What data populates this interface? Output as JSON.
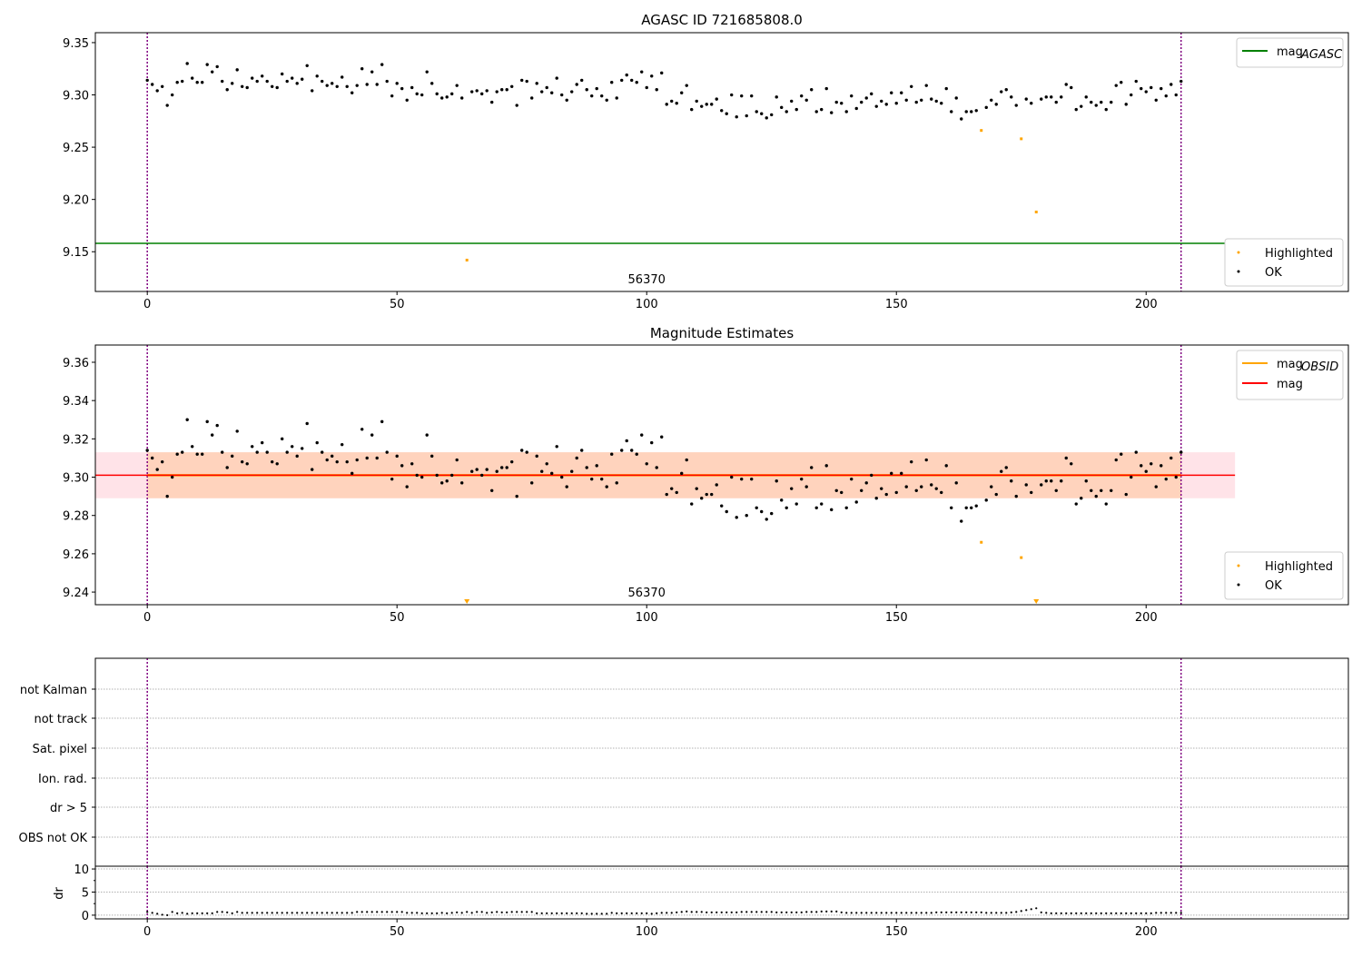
{
  "colors": {
    "ok": "#000000",
    "highlighted": "#ffa500",
    "agasc": "#008000",
    "obsid": "#ffa500",
    "mag": "#ff0000",
    "obs_line": "#800080",
    "band_mag": "#ffc0cb",
    "band_obsid": "#ffc8a0",
    "grid": "#b0b0b0"
  },
  "chart_data": [
    {
      "type": "scatter",
      "title": "AGASC ID 721685808.0",
      "xlim": [
        -10.4,
        240.5
      ],
      "ylim": [
        9.112,
        9.3595
      ],
      "xticks": [
        0,
        50,
        100,
        150,
        200
      ],
      "yticks": [
        9.15,
        9.2,
        9.25,
        9.3,
        9.35
      ],
      "obs_lines": [
        0,
        207
      ],
      "annotation": {
        "text": "56370",
        "x": 100
      },
      "mag_agasc": {
        "value": 9.158,
        "xrange": [
          -10.4,
          217.8
        ]
      },
      "legend_lines": [
        {
          "label": "mag",
          "sub": "AGASC",
          "color_key": "agasc"
        }
      ],
      "legend_points": [
        "Highlighted",
        "OK"
      ],
      "legend_placement": [
        "upper-right",
        "lower-right"
      ],
      "ok": [
        9.314,
        9.31,
        9.304,
        9.308,
        9.29,
        9.3,
        9.312,
        9.313,
        9.33,
        9.316,
        9.312,
        9.312,
        9.329,
        9.322,
        9.327,
        9.313,
        9.305,
        9.311,
        9.324,
        9.308,
        9.307,
        9.316,
        9.313,
        9.318,
        9.313,
        9.308,
        9.307,
        9.32,
        9.313,
        9.316,
        9.311,
        9.315,
        9.328,
        9.304,
        9.318,
        9.313,
        9.309,
        9.311,
        9.308,
        9.317,
        9.308,
        9.302,
        9.309,
        9.325,
        9.31,
        9.322,
        9.31,
        9.329,
        9.313,
        9.299,
        9.311,
        9.306,
        9.295,
        9.307,
        9.301,
        9.3,
        9.322,
        9.311,
        9.301,
        9.297,
        9.298,
        9.301,
        9.309,
        9.297,
        null,
        9.303,
        9.304,
        9.301,
        9.304,
        9.293,
        9.303,
        9.305,
        9.305,
        9.308,
        9.29,
        9.314,
        9.313,
        9.297,
        9.311,
        9.303,
        9.307,
        9.302,
        9.316,
        9.3,
        9.295,
        9.303,
        9.31,
        9.314,
        9.305,
        9.299,
        9.306,
        9.299,
        9.295,
        9.312,
        9.297,
        9.314,
        9.319,
        9.314,
        9.312,
        9.322,
        9.307,
        9.318,
        9.305,
        9.321,
        9.291,
        9.294,
        9.292,
        9.302,
        9.309,
        9.286,
        9.294,
        9.289,
        9.291,
        9.291,
        9.296,
        9.285,
        9.282,
        9.3,
        9.279,
        9.299,
        9.28,
        9.299,
        9.284,
        9.282,
        9.278,
        9.281,
        9.298,
        9.288,
        9.284,
        9.294,
        9.286,
        9.299,
        9.295,
        9.305,
        9.284,
        9.286,
        9.306,
        9.283,
        9.293,
        9.292,
        9.284,
        9.299,
        9.287,
        9.293,
        9.297,
        9.301,
        9.289,
        9.294,
        9.291,
        9.302,
        9.292,
        9.302,
        9.295,
        9.308,
        9.293,
        9.295,
        9.309,
        9.296,
        9.294,
        9.292,
        9.306,
        9.284,
        9.297,
        9.277,
        9.284,
        9.284,
        9.285,
        null,
        9.288,
        9.295,
        9.291,
        9.303,
        9.305,
        9.298,
        9.29,
        null,
        9.296,
        9.292,
        null,
        9.296,
        9.298,
        9.298,
        9.293,
        9.298,
        9.31,
        9.307,
        9.286,
        9.289,
        9.298,
        9.293,
        9.29,
        9.293,
        9.286,
        9.293,
        9.309,
        9.312,
        9.291,
        9.3,
        9.313,
        9.306,
        9.303,
        9.307,
        9.295,
        9.306,
        9.299,
        9.31,
        9.3,
        9.313
      ],
      "highlighted": [
        {
          "x": 64,
          "y": 9.142
        },
        {
          "x": 167,
          "y": 9.266
        },
        {
          "x": 175,
          "y": 9.258
        },
        {
          "x": 178,
          "y": 9.188
        }
      ]
    },
    {
      "type": "scatter",
      "title": "Magnitude Estimates",
      "xlim": [
        -10.4,
        240.5
      ],
      "ylim": [
        9.2334,
        9.369
      ],
      "xticks": [
        0,
        50,
        100,
        150,
        200
      ],
      "yticks": [
        9.24,
        9.26,
        9.28,
        9.3,
        9.32,
        9.34,
        9.36
      ],
      "obs_lines": [
        0,
        207
      ],
      "annotation": {
        "text": "56370",
        "x": 100
      },
      "mag": {
        "value": 9.301,
        "band": [
          9.289,
          9.313
        ],
        "xrange": [
          -10.4,
          217.8
        ]
      },
      "mag_obsid": {
        "value": 9.301,
        "band": [
          9.289,
          9.313
        ],
        "xrange": [
          0,
          207
        ]
      },
      "legend_lines": [
        {
          "label": "mag",
          "sub": "OBSID",
          "color_key": "obsid"
        },
        {
          "label": "mag",
          "sub": "",
          "color_key": "mag"
        }
      ],
      "legend_points": [
        "Highlighted",
        "OK"
      ],
      "legend_placement": [
        "upper-right",
        "lower-right"
      ],
      "highlighted_in_range": [
        {
          "x": 167,
          "y": 9.266
        },
        {
          "x": 175,
          "y": 9.258
        }
      ],
      "highlighted_below_range": [
        64,
        178
      ]
    },
    {
      "type": "scatter",
      "flags": [
        "not Kalman",
        "not track",
        "Sat. pixel",
        "Ion. rad.",
        "dr > 5",
        "OBS not OK"
      ],
      "xlim": [
        -10.4,
        240.5
      ],
      "obs_lines": [
        0,
        207
      ]
    },
    {
      "type": "scatter",
      "ylabel": "dr",
      "xlim": [
        -10.4,
        240.5
      ],
      "ylim": [
        -0.8,
        10.6
      ],
      "xticks": [
        0,
        50,
        100,
        150,
        200
      ],
      "yticks": [
        0,
        5,
        10
      ],
      "obs_lines": [
        0,
        207
      ],
      "dr": [
        0.7,
        0.5,
        0.3,
        0.1,
        0.0,
        0.7,
        0.4,
        0.5,
        0.3,
        0.4,
        0.4,
        0.4,
        0.4,
        0.4,
        0.7,
        0.7,
        0.6,
        0.4,
        0.7,
        0.5,
        0.5,
        0.5,
        0.5,
        0.5,
        0.5,
        0.5,
        0.5,
        0.5,
        0.5,
        0.5,
        0.5,
        0.5,
        0.5,
        0.5,
        0.5,
        0.5,
        0.5,
        0.5,
        0.5,
        0.5,
        0.5,
        0.5,
        0.7,
        0.7,
        0.7,
        0.7,
        0.7,
        0.7,
        0.7,
        0.7,
        0.7,
        0.7,
        0.5,
        0.5,
        0.5,
        0.4,
        0.4,
        0.4,
        0.4,
        0.5,
        0.4,
        0.5,
        0.6,
        0.5,
        0.7,
        0.5,
        0.7,
        0.7,
        0.5,
        0.6,
        0.7,
        0.6,
        0.6,
        0.7,
        0.7,
        0.7,
        0.7,
        0.7,
        0.4,
        0.4,
        0.4,
        0.4,
        0.4,
        0.4,
        0.4,
        0.4,
        0.4,
        0.4,
        0.3,
        0.3,
        0.3,
        0.3,
        0.3,
        0.5,
        0.4,
        0.4,
        0.4,
        0.4,
        0.4,
        0.4,
        0.4,
        0.3,
        0.4,
        0.5,
        0.5,
        0.5,
        0.6,
        0.7,
        0.8,
        0.7,
        0.7,
        0.7,
        0.6,
        0.6,
        0.6,
        0.6,
        0.6,
        0.6,
        0.6,
        0.7,
        0.7,
        0.7,
        0.7,
        0.7,
        0.7,
        0.7,
        0.6,
        0.6,
        0.6,
        0.6,
        0.6,
        0.6,
        0.7,
        0.7,
        0.7,
        0.8,
        0.8,
        0.8,
        0.8,
        0.6,
        0.5,
        0.5,
        0.5,
        0.5,
        0.5,
        0.5,
        0.5,
        0.5,
        0.5,
        0.5,
        0.5,
        0.5,
        0.5,
        0.5,
        0.5,
        0.5,
        0.5,
        0.5,
        0.6,
        0.6,
        0.6,
        0.6,
        0.6,
        0.6,
        0.6,
        0.6,
        0.6,
        0.6,
        0.5,
        0.5,
        0.5,
        0.5,
        0.5,
        0.6,
        0.7,
        0.9,
        1.1,
        1.3,
        1.5,
        0.6,
        0.5,
        0.4,
        0.4,
        0.4,
        0.4,
        0.4,
        0.4,
        0.4,
        0.4,
        0.4,
        0.4,
        0.4,
        0.4,
        0.4,
        0.4,
        0.4,
        0.4,
        0.4,
        0.4,
        0.4,
        0.4,
        0.4,
        0.5,
        0.5,
        0.5,
        0.5,
        0.5,
        0.5
      ]
    }
  ]
}
